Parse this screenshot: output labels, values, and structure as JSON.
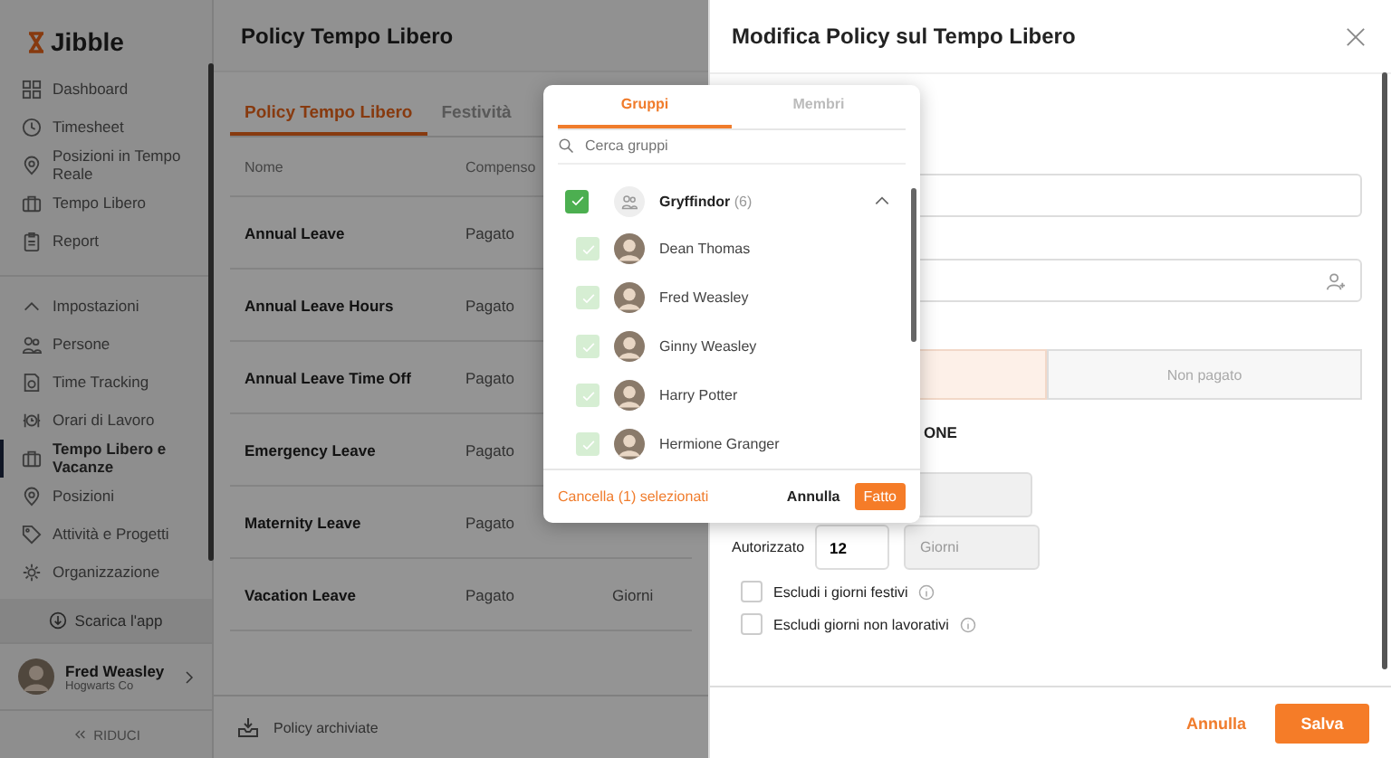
{
  "sidebar": {
    "logo": "Jibble",
    "nav": [
      {
        "label": "Dashboard",
        "selected": false
      },
      {
        "label": "Timesheet",
        "selected": false
      },
      {
        "label": "Posizioni in Tempo Reale",
        "selected": false
      },
      {
        "label": "Tempo Libero",
        "selected": false
      },
      {
        "label": "Report",
        "selected": false
      }
    ],
    "settings_header": {
      "label": "Impostazioni",
      "expanded": true
    },
    "settings": [
      {
        "label": "Persone",
        "selected": false
      },
      {
        "label": "Time Tracking",
        "selected": false
      },
      {
        "label": "Orari di Lavoro",
        "selected": false
      },
      {
        "label": "Tempo Libero e Vacanze",
        "selected": true
      },
      {
        "label": "Posizioni",
        "selected": false
      },
      {
        "label": "Attività e Progetti",
        "selected": false
      },
      {
        "label": "Organizzazione",
        "selected": false
      }
    ],
    "download": "Scarica l'app",
    "user": {
      "name": "Fred Weasley",
      "org": "Hogwarts Co"
    },
    "collapse": "RIDUCI"
  },
  "main": {
    "title": "Policy Tempo Libero",
    "tabs": [
      {
        "label": "Policy Tempo Libero",
        "selected": true
      },
      {
        "label": "Festività",
        "selected": false
      }
    ],
    "columns": [
      "Nome",
      "Compenso"
    ],
    "rows": [
      {
        "name": "Annual Leave",
        "pay": "Pagato"
      },
      {
        "name": "Annual Leave Hours",
        "pay": "Pagato"
      },
      {
        "name": "Annual Leave Time Off",
        "pay": "Pagato"
      },
      {
        "name": "Emergency Leave",
        "pay": "Pagato"
      },
      {
        "name": "Maternity Leave",
        "pay": "Pagato"
      },
      {
        "name": "Vacation Leave",
        "pay": "Pagato",
        "column_3": "Giorni"
      }
    ],
    "archived": "Policy archiviate"
  },
  "panel": {
    "title": "Modifica Policy sul Tempo Libero",
    "pay_options": [
      {
        "selected": true
      },
      {
        "label": "Non pagato",
        "selected": false
      }
    ],
    "section": "ONE",
    "allowed_label": "Autorizzato",
    "allowed_value": "12",
    "allowed_unit": "Giorni",
    "options": [
      {
        "label": "Escludi i giorni festivi",
        "checked": false
      },
      {
        "label": "Escludi giorni non lavorativi",
        "checked": false
      }
    ],
    "cancel": "Annulla",
    "save": "Salva"
  },
  "picker": {
    "tabs": [
      {
        "label": "Gruppi",
        "selected": true
      },
      {
        "label": "Membri",
        "selected": false
      }
    ],
    "search": {
      "placeholder": "Cerca gruppi"
    },
    "group": {
      "name": "Gryffindor",
      "count": "(6)",
      "checked": true,
      "expanded": true
    },
    "members": [
      {
        "name": "Dean Thomas",
        "checked": true,
        "disabled": true
      },
      {
        "name": "Fred Weasley",
        "checked": true,
        "disabled": true
      },
      {
        "name": "Ginny Weasley",
        "checked": true,
        "disabled": true
      },
      {
        "name": "Harry Potter",
        "checked": true,
        "disabled": true
      },
      {
        "name": "Hermione Granger",
        "checked": true,
        "disabled": true
      }
    ],
    "clear": "Cancella (1) selezionati",
    "cancel": "Annulla",
    "done": "Fatto"
  }
}
